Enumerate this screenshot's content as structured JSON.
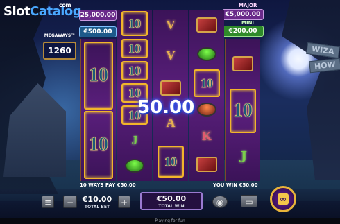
{
  "logo": {
    "part1": "Slot",
    "part2": "Catalog",
    "suffix": "com"
  },
  "jackpots": {
    "left_top_value": "25,000.00",
    "left_bottom_value": "€500.00",
    "right_top_label": "MAJOR",
    "right_top_value": "€5,000.00",
    "right_bottom_label": "MINI",
    "right_bottom_value": "€200.00"
  },
  "megaways": {
    "label": "MEGAWAYS™",
    "value": "1260"
  },
  "big_win_amount": "50.00",
  "ways_pay_text": "10 WAYS PAY €50.00",
  "you_win_text": "YOU WIN €50.00",
  "bet": {
    "value": "€10.00",
    "label": "TOTAL BET"
  },
  "total_win": {
    "value": "€50.00",
    "label": "TOTAL WIN"
  },
  "signpost": [
    "WIZA",
    "HOW"
  ],
  "footer_text": "Playing for fun",
  "symbols": {
    "ten": "10",
    "v": "V",
    "a": "A",
    "k": "K",
    "j": "J"
  },
  "colors": {
    "gold": "#f2b52b",
    "reel_purple": "#5a1f7c",
    "jackpot_green": "#2f8a2a",
    "jackpot_purple": "#6a2a8a"
  }
}
